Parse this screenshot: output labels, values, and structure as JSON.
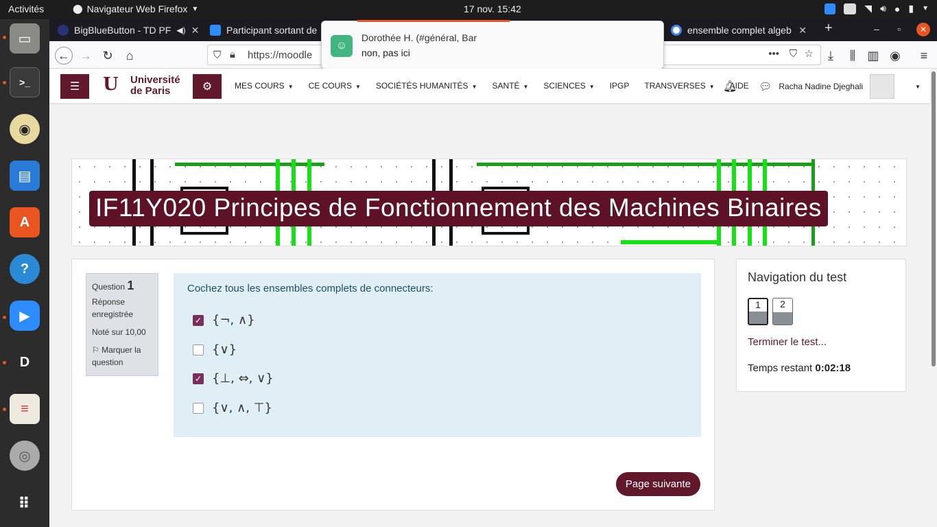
{
  "topbar": {
    "activities": "Activités",
    "app_menu": "Navigateur Web Firefox",
    "datetime": "17 nov.  15:42"
  },
  "dock": {
    "apps": [
      "files-icon",
      "terminal-icon",
      "rhythmbox-icon",
      "writer-icon",
      "software-icon",
      "help-icon",
      "zoom-icon",
      "logisim-icon",
      "reader-icon",
      "disc-icon",
      "grid-icon"
    ]
  },
  "tabs": [
    {
      "label": "BigBlueButton - TD PF",
      "favcolor": "#283274"
    },
    {
      "label": "Participant sortant de",
      "favcolor": "#2d8cff"
    },
    {
      "label": "ensemble complet algeb",
      "favcolor": "#ffffff"
    }
  ],
  "urlbar": {
    "url": "https://moodle"
  },
  "notification": {
    "title": "Dorothée H. (#général, Bar",
    "body": "non, pas ici"
  },
  "moodle": {
    "logo_line1": "Université",
    "logo_line2": "de Paris",
    "menu": [
      "MES COURS",
      "CE COURS",
      "SOCIÉTÉS HUMANITÉS",
      "SANTÉ",
      "SCIENCES",
      "IPGP",
      "TRANSVERSES",
      "AIDE"
    ],
    "user_name": "Racha Nadine Djeghali"
  },
  "course_title": "IF11Y020 Principes de Fonctionnement des Machines Binaires",
  "question": {
    "label": "Question",
    "number": "1",
    "state": "Réponse enregistrée",
    "grade": "Noté sur 10,00",
    "flag": "Marquer la question",
    "prompt": "Cochez tous les ensembles complets de connecteurs:",
    "options": [
      {
        "text": "{¬, ∧}",
        "checked": true
      },
      {
        "text": "{∨}",
        "checked": false
      },
      {
        "text": "{⊥, ⇔, ∨}",
        "checked": true
      },
      {
        "text": "{∨, ∧, ⊤}",
        "checked": false
      }
    ],
    "next": "Page suivante"
  },
  "quiz_nav": {
    "heading": "Navigation du test",
    "pages": [
      "1",
      "2"
    ],
    "finish": "Terminer le test...",
    "time_label": "Temps restant",
    "time_value": "0:02:18"
  },
  "colors": {
    "brand": "#62182b",
    "checked": "#7a2e5c",
    "question_bg": "#e0eff5"
  }
}
